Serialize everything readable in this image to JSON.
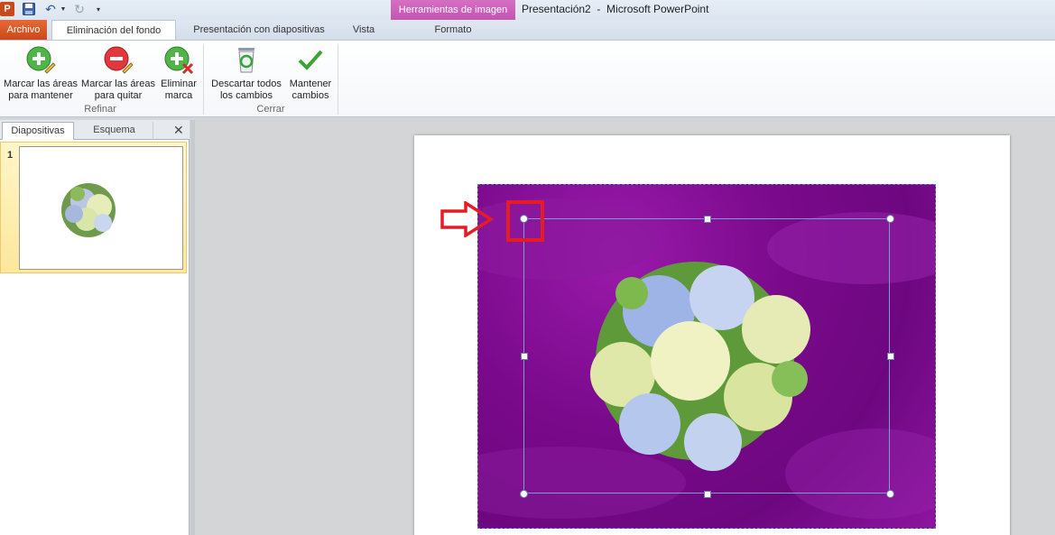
{
  "window": {
    "title": "Presentación2  -  Microsoft PowerPoint",
    "app_logo": "P",
    "context_group": "Herramientas de imagen"
  },
  "quick_access": {
    "icons": [
      "save-icon",
      "undo-icon",
      "redo-icon",
      "customize-icon"
    ],
    "undo_glyph": "↶",
    "redo_glyph": "↻",
    "dropdown_glyph": "▼",
    "customize_glyph": "▾"
  },
  "tabs": [
    {
      "label": "Archivo"
    },
    {
      "label": "Eliminación del fondo",
      "active": true
    },
    {
      "label": "Presentación con diapositivas"
    },
    {
      "label": "Vista"
    },
    {
      "label": "Formato"
    }
  ],
  "ribbon": {
    "groups": [
      {
        "label": "Refinar"
      },
      {
        "label": "Cerrar"
      }
    ],
    "buttons": [
      {
        "label": "Marcar las áreas\npara mantener",
        "icon": "plus-pencil-icon"
      },
      {
        "label": "Marcar las áreas\npara quitar",
        "icon": "minus-pencil-icon"
      },
      {
        "label": "Eliminar\nmarca",
        "icon": "delete-mark-icon"
      },
      {
        "label": "Descartar todos\nlos cambios",
        "icon": "recycle-bin-icon"
      },
      {
        "label": "Mantener\ncambios",
        "icon": "checkmark-icon"
      }
    ]
  },
  "slides_pane": {
    "tabs": [
      {
        "label": "Diapositivas",
        "active": true
      },
      {
        "label": "Esquema"
      }
    ],
    "close_glyph": "✕",
    "slides": [
      {
        "number": "1",
        "selected": true
      }
    ]
  },
  "colors": {
    "accent_orange": "#c9491a",
    "context_pink": "#c355b2",
    "removal_overlay": "#7a0a8b",
    "highlight_red": "#e61c24",
    "selection_blue": "#7e9bd0"
  }
}
